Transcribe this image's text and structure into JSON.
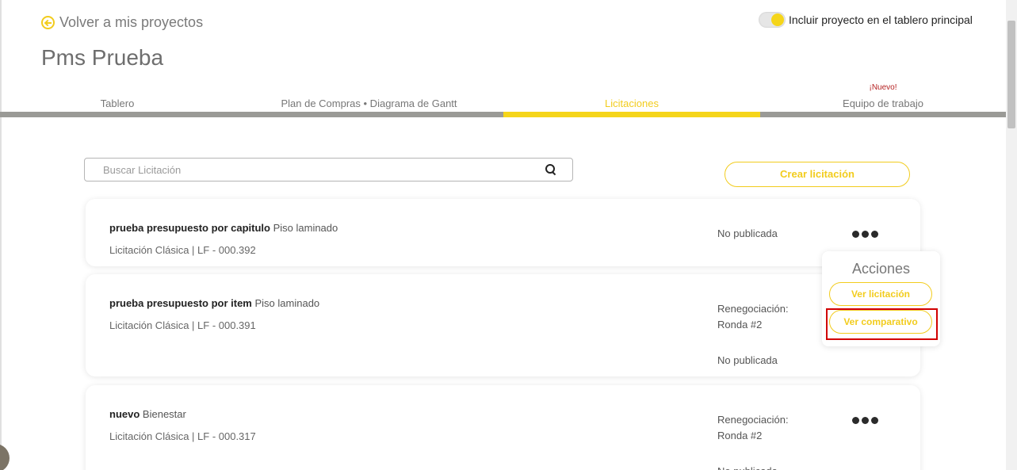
{
  "header": {
    "back_label": "Volver a mis proyectos",
    "toggle_label": "Incluir proyecto en el tablero principal",
    "toggle_on": true,
    "project_title": "Pms Prueba"
  },
  "tabs": [
    {
      "label": "Tablero",
      "active": false
    },
    {
      "label": "Plan de Compras • Diagrama de Gantt",
      "active": false
    },
    {
      "label": "Licitaciones",
      "active": true
    },
    {
      "label": "Equipo de trabajo",
      "active": false,
      "badge": "¡Nuevo!"
    }
  ],
  "search": {
    "placeholder": "Buscar Licitación",
    "value": ""
  },
  "create_button": "Crear licitación",
  "licitaciones": [
    {
      "name": "prueba presupuesto por capitulo",
      "category": "Piso laminado",
      "sub": "Licitación Clásica | LF - 000.392",
      "status_lines": [
        "No publicada"
      ]
    },
    {
      "name": "prueba presupuesto por item",
      "category": "Piso laminado",
      "sub": "Licitación Clásica | LF - 000.391",
      "status_lines": [
        "Renegociación:",
        "Ronda #2"
      ],
      "status_extra": "No publicada"
    },
    {
      "name": "nuevo",
      "category": "Bienestar",
      "sub": "Licitación Clásica | LF - 000.317",
      "status_lines": [
        "Renegociación:",
        "Ronda #2"
      ],
      "status_extra": "No publicada"
    }
  ],
  "actions_menu": {
    "title": "Acciones",
    "view_label": "Ver licitación",
    "compare_label": "Ver comparativo"
  },
  "colors": {
    "accent": "#f5d51a",
    "tab_bar": "#9a9a96",
    "badge": "#b52222",
    "highlight": "#d10000"
  }
}
